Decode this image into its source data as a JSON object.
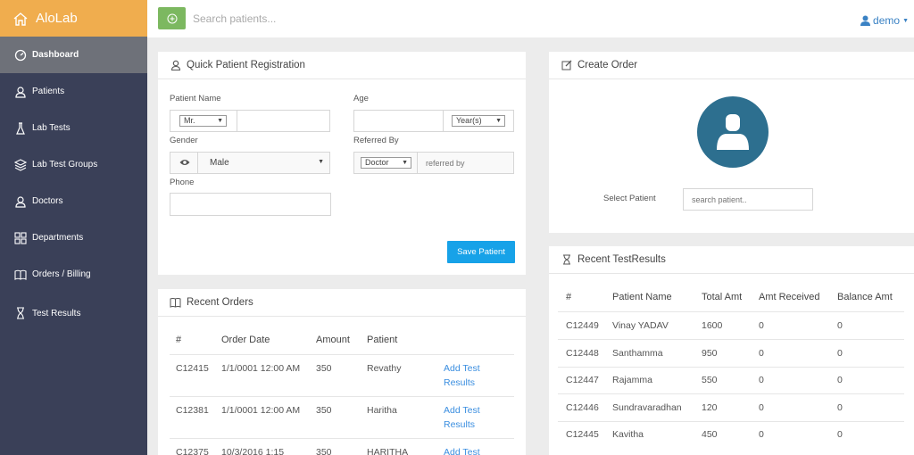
{
  "brand": {
    "name": "AloLab"
  },
  "sidebar": {
    "items": [
      {
        "label": "Dashboard",
        "icon": "gauge-icon"
      },
      {
        "label": "Patients",
        "icon": "user-icon"
      },
      {
        "label": "Lab Tests",
        "icon": "flask-icon"
      },
      {
        "label": "Lab Test Groups",
        "icon": "layers-icon"
      },
      {
        "label": "Doctors",
        "icon": "user-icon"
      },
      {
        "label": "Departments",
        "icon": "grid-icon"
      },
      {
        "label": "Orders / Billing",
        "icon": "book-icon"
      },
      {
        "label": "Test Results",
        "icon": "hourglass-icon"
      }
    ]
  },
  "topbar": {
    "search_placeholder": "Search patients...",
    "user": "demo"
  },
  "registration": {
    "title": "Quick Patient Registration",
    "patient_name_label": "Patient Name",
    "salutation": "Mr.",
    "age_label": "Age",
    "age_unit": "Year(s)",
    "gender_label": "Gender",
    "gender_value": "Male",
    "referred_by_label": "Referred By",
    "referred_type": "Doctor",
    "referred_placeholder": "referred by",
    "phone_label": "Phone",
    "save_label": "Save Patient"
  },
  "create_order": {
    "title": "Create Order",
    "select_label": "Select Patient",
    "search_placeholder": "search patient.."
  },
  "recent_orders": {
    "title": "Recent Orders",
    "headers": [
      "#",
      "Order Date",
      "Amount",
      "Patient"
    ],
    "rows": [
      {
        "id": "C12415",
        "date": "1/1/0001 12:00 AM",
        "amount": "350",
        "patient": "Revathy",
        "action": "Add Test Results"
      },
      {
        "id": "C12381",
        "date": "1/1/0001 12:00 AM",
        "amount": "350",
        "patient": "Haritha",
        "action": "Add Test Results"
      },
      {
        "id": "C12375",
        "date": "10/3/2016 1:15",
        "amount": "350",
        "patient": "HARITHA",
        "action": "Add Test"
      }
    ]
  },
  "recent_results": {
    "title": "Recent TestResults",
    "headers": [
      "#",
      "Patient Name",
      "Total Amt",
      "Amt Received",
      "Balance Amt"
    ],
    "rows": [
      {
        "id": "C12449",
        "name": "Vinay YADAV",
        "total": "1600",
        "received": "0",
        "balance": "0"
      },
      {
        "id": "C12448",
        "name": "Santhamma",
        "total": "950",
        "received": "0",
        "balance": "0"
      },
      {
        "id": "C12447",
        "name": "Rajamma",
        "total": "550",
        "received": "0",
        "balance": "0"
      },
      {
        "id": "C12446",
        "name": "Sundravaradhan",
        "total": "120",
        "received": "0",
        "balance": "0"
      },
      {
        "id": "C12445",
        "name": "Kavitha",
        "total": "450",
        "received": "0",
        "balance": "0"
      }
    ]
  },
  "colors": {
    "sidebar": "#3a4058",
    "brand": "#f0ad4e",
    "accent": "#17a2e8",
    "add_button": "#7cb860",
    "avatar": "#2d6f8f"
  }
}
